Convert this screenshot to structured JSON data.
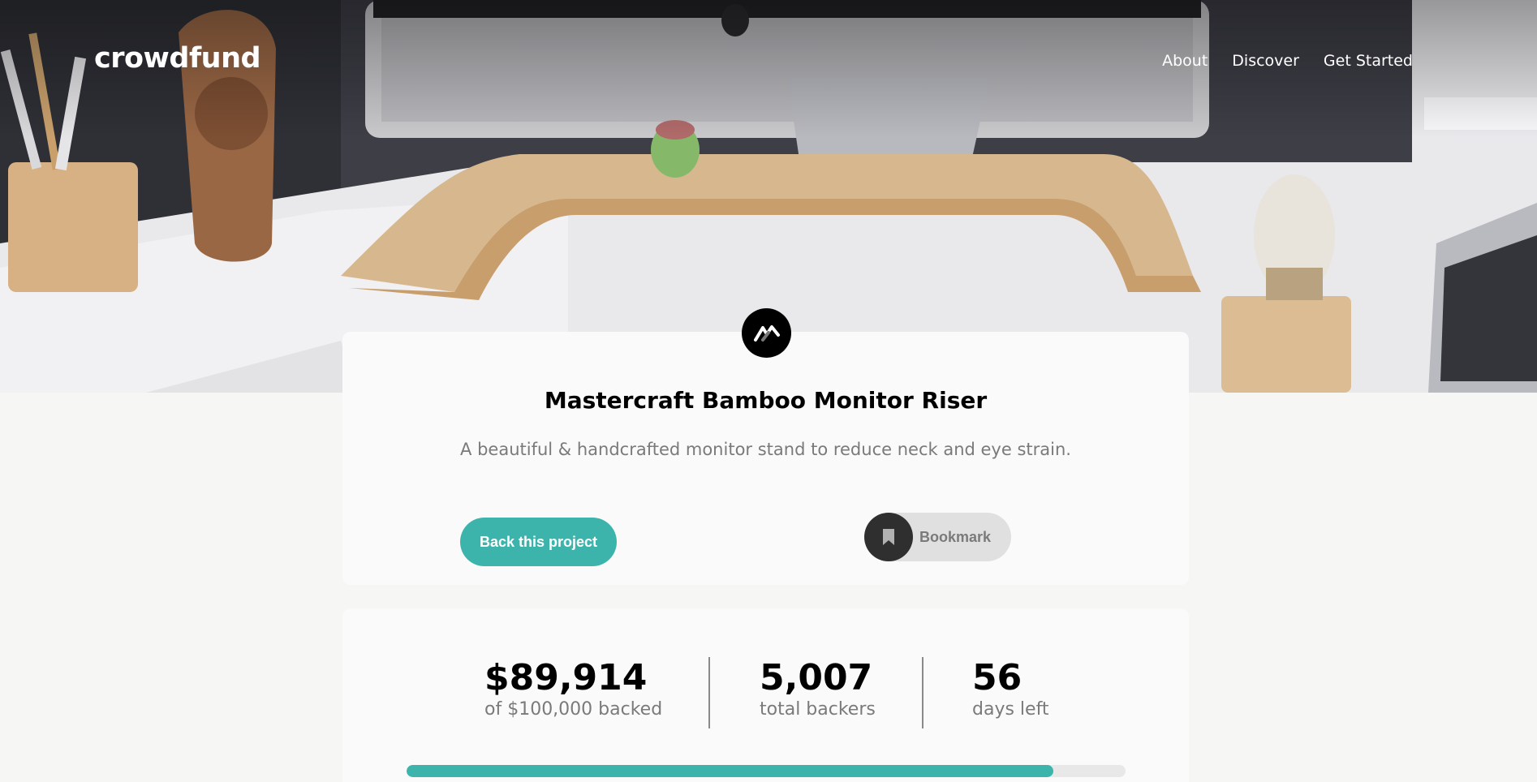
{
  "header": {
    "logo": "crowdfund",
    "nav": [
      "About",
      "Discover",
      "Get Started"
    ]
  },
  "project": {
    "logo_icon": "mastercraft-logo-icon",
    "title": "Mastercraft Bamboo Monitor Riser",
    "subtitle": "A beautiful & handcrafted monitor stand to reduce neck and eye strain.",
    "back_label": "Back this project",
    "bookmark_label": "Bookmark",
    "bookmark_icon": "bookmark-icon"
  },
  "stats": [
    {
      "value": "$89,914",
      "label": "of $100,000 backed"
    },
    {
      "value": "5,007",
      "label": "total backers"
    },
    {
      "value": "56",
      "label": "days left"
    }
  ],
  "progress": {
    "fraction": 0.899
  },
  "colors": {
    "accent": "#3cb4ac",
    "dark": "#2f2f2f",
    "muted": "#7a7a7a"
  }
}
